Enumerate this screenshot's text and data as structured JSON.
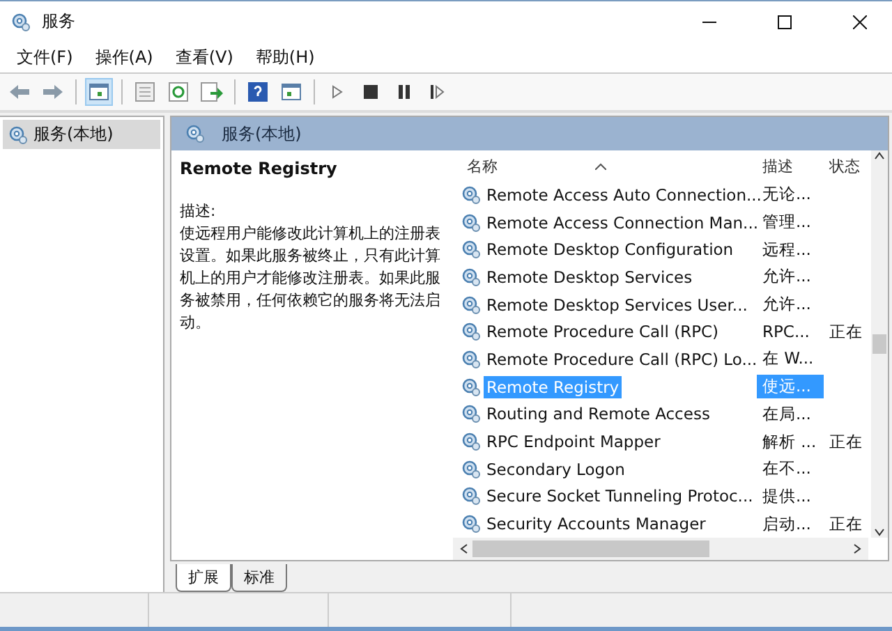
{
  "window": {
    "title": "服务"
  },
  "menu": [
    "文件(F)",
    "操作(A)",
    "查看(V)",
    "帮助(H)"
  ],
  "tree": [
    {
      "label": "服务(本地)",
      "selected": true
    }
  ],
  "panel_header": {
    "title": "服务(本地)"
  },
  "detail": {
    "title": "Remote Registry",
    "description_label": "描述:",
    "description": "使远程用户能修改此计算机上的注册表设置。如果此服务被终止，只有此计算机上的用户才能修改注册表。如果此服务被禁用，任何依赖它的服务将无法启动。"
  },
  "table": {
    "columns": [
      "名称",
      "描述",
      "状态"
    ],
    "rows": [
      {
        "name": "Remote Access Auto Connection...",
        "description": "无论...",
        "status": "",
        "selected": false
      },
      {
        "name": "Remote Access Connection Man...",
        "description": "管理...",
        "status": "",
        "selected": false
      },
      {
        "name": "Remote Desktop Configuration",
        "description": "远程...",
        "status": "",
        "selected": false
      },
      {
        "name": "Remote Desktop Services",
        "description": "允许...",
        "status": "",
        "selected": false
      },
      {
        "name": "Remote Desktop Services User...",
        "description": "允许...",
        "status": "",
        "selected": false
      },
      {
        "name": "Remote Procedure Call (RPC)",
        "description": "RPC...",
        "status": "正在",
        "selected": false
      },
      {
        "name": "Remote Procedure Call (RPC) Lo...",
        "description": "在 W...",
        "status": "",
        "selected": false
      },
      {
        "name": "Remote Registry",
        "description": "使远...",
        "status": "",
        "selected": true
      },
      {
        "name": "Routing and Remote Access",
        "description": "在局...",
        "status": "",
        "selected": false
      },
      {
        "name": "RPC Endpoint Mapper",
        "description": "解析 ...",
        "status": "正在",
        "selected": false
      },
      {
        "name": "Secondary Logon",
        "description": "在不...",
        "status": "",
        "selected": false
      },
      {
        "name": "Secure Socket Tunneling Protoc...",
        "description": "提供...",
        "status": "",
        "selected": false
      },
      {
        "name": "Security Accounts Manager",
        "description": "启动...",
        "status": "正在",
        "selected": false
      }
    ]
  },
  "tabs": [
    {
      "label": "扩展",
      "selected": true
    },
    {
      "label": "标准",
      "selected": false
    }
  ]
}
